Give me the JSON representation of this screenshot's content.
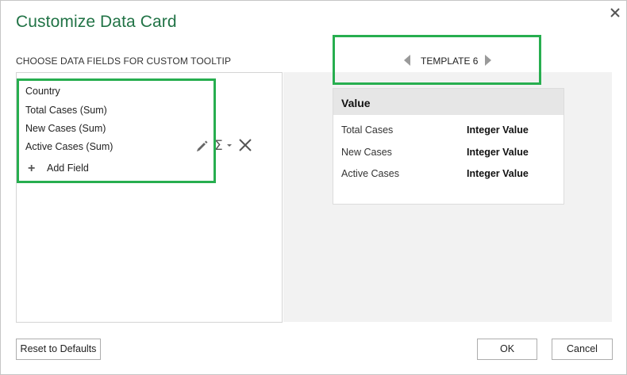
{
  "dialog": {
    "title": "Customize Data Card",
    "close_icon": "close-icon"
  },
  "fields_section": {
    "label": "CHOOSE DATA FIELDS FOR CUSTOM TOOLTIP",
    "fields": [
      "Country",
      "Total Cases (Sum)",
      "New Cases (Sum)",
      "Active Cases (Sum)"
    ],
    "add_field_label": "Add Field",
    "row_tools": [
      "pencil-icon",
      "sigma-dropdown-icon",
      "delete-x-icon"
    ]
  },
  "template": {
    "label": "TEMPLATE 6",
    "prev_icon": "triangle-left-icon",
    "next_icon": "triangle-right-icon"
  },
  "card": {
    "header": "Value",
    "rows": [
      {
        "label": "Total Cases",
        "value": "Integer Value"
      },
      {
        "label": "New Cases",
        "value": "Integer Value"
      },
      {
        "label": "Active Cases",
        "value": "Integer Value"
      }
    ]
  },
  "buttons": {
    "reset": "Reset to Defaults",
    "ok": "OK",
    "cancel": "Cancel"
  },
  "colors": {
    "title": "#217346",
    "highlight": "#27ae4f",
    "preview_bg": "#f2f2f2"
  }
}
